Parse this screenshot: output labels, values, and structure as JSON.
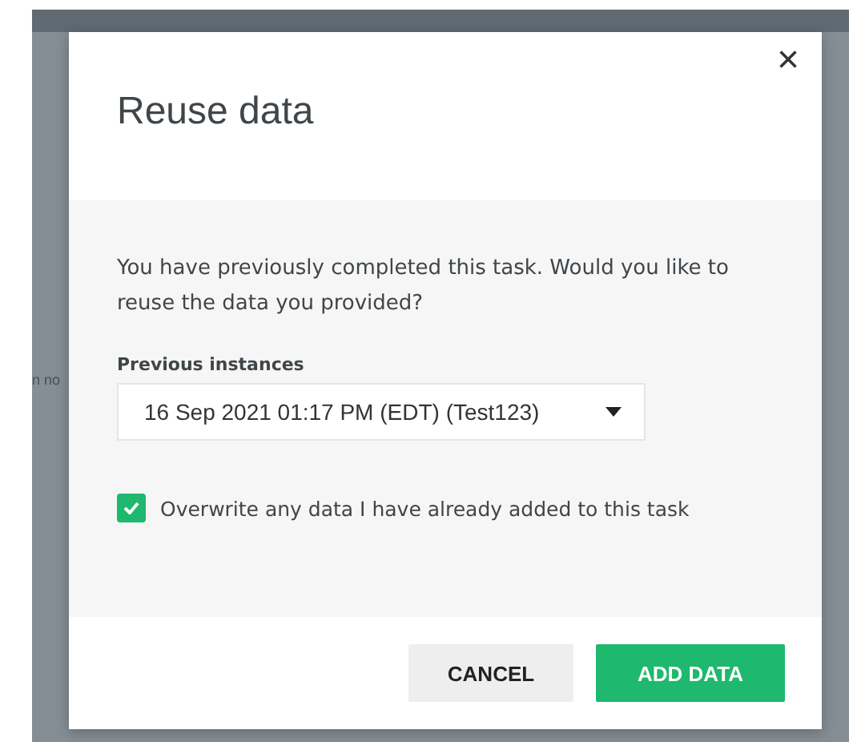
{
  "background": {
    "texts": [
      "n no"
    ]
  },
  "dialog": {
    "title": "Reuse data",
    "close": "×",
    "message": "You have previously completed this task. Would you like to reuse the data you provided?",
    "select": {
      "label": "Previous instances",
      "value": "16 Sep 2021 01:17 PM (EDT) (Test123)"
    },
    "checkbox": {
      "label": "Overwrite any data I have already added to this task",
      "checked": true
    },
    "buttons": [
      {
        "label": "CANCEL",
        "kind": "secondary"
      },
      {
        "label": "ADD DATA",
        "kind": "primary"
      }
    ]
  }
}
